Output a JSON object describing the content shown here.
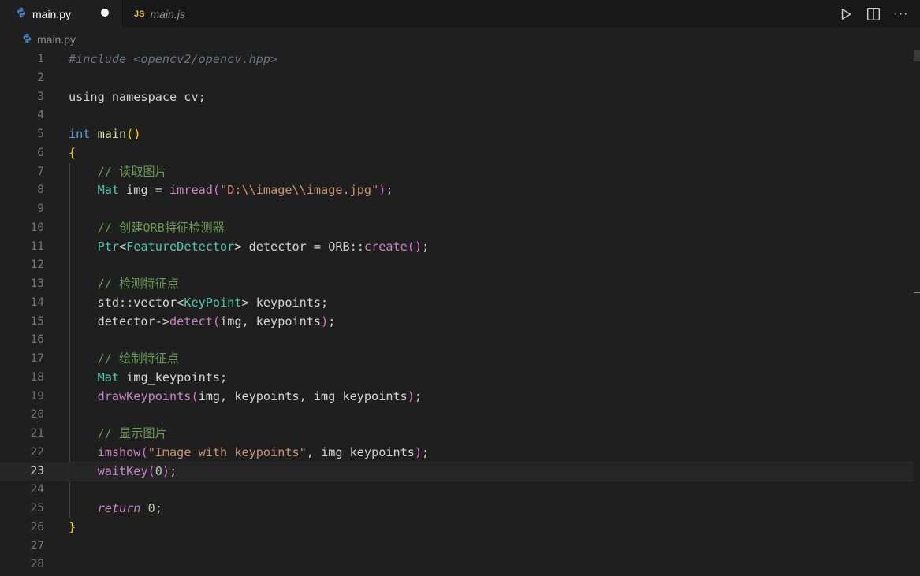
{
  "tabs": [
    {
      "label": "main.py",
      "icon": "python-icon",
      "active": true,
      "dirty": true
    },
    {
      "label": "main.js",
      "icon": "js-icon",
      "icon_text": "JS",
      "active": false
    }
  ],
  "actions": [
    {
      "name": "run-button",
      "icon": "play-icon"
    },
    {
      "name": "split-editor-button",
      "icon": "split-icon"
    },
    {
      "name": "more-actions-button",
      "icon": "ellipsis-icon",
      "glyph": "···"
    }
  ],
  "breadcrumb": {
    "file": "main.py",
    "icon": "python-icon"
  },
  "editor": {
    "current_line": 23,
    "lines": [
      {
        "n": "1",
        "tokens": [
          [
            "pp",
            "#include <opencv2/opencv.hpp>"
          ]
        ]
      },
      {
        "n": "2",
        "tokens": []
      },
      {
        "n": "3",
        "tokens": [
          [
            "pl",
            "using namespace cv;"
          ]
        ]
      },
      {
        "n": "4",
        "tokens": []
      },
      {
        "n": "5",
        "tokens": [
          [
            "kw",
            "int"
          ],
          [
            "pl",
            " "
          ],
          [
            "fn",
            "main"
          ],
          [
            "br",
            "()"
          ]
        ]
      },
      {
        "n": "6",
        "tokens": [
          [
            "br",
            "{"
          ]
        ]
      },
      {
        "n": "7",
        "tokens": [
          [
            "pl",
            "    "
          ],
          [
            "cm",
            "// 读取图片"
          ]
        ]
      },
      {
        "n": "8",
        "tokens": [
          [
            "pl",
            "    "
          ],
          [
            "ty",
            "Mat"
          ],
          [
            "pl",
            " img = "
          ],
          [
            "lfn",
            "imread"
          ],
          [
            "br2",
            "("
          ],
          [
            "str",
            "\"D:\\\\image\\\\image.jpg\""
          ],
          [
            "br2",
            ")"
          ],
          [
            "pl",
            ";"
          ]
        ]
      },
      {
        "n": "9",
        "tokens": []
      },
      {
        "n": "10",
        "tokens": [
          [
            "pl",
            "    "
          ],
          [
            "cm",
            "// 创建ORB特征检测器"
          ]
        ]
      },
      {
        "n": "11",
        "tokens": [
          [
            "pl",
            "    "
          ],
          [
            "ty",
            "Ptr"
          ],
          [
            "pl",
            "<"
          ],
          [
            "ty",
            "FeatureDetector"
          ],
          [
            "pl",
            "> detector = ORB::"
          ],
          [
            "lfn",
            "create"
          ],
          [
            "br2",
            "()"
          ],
          [
            "pl",
            ";"
          ]
        ]
      },
      {
        "n": "12",
        "tokens": []
      },
      {
        "n": "13",
        "tokens": [
          [
            "pl",
            "    "
          ],
          [
            "cm",
            "// 检测特征点"
          ]
        ]
      },
      {
        "n": "14",
        "tokens": [
          [
            "pl",
            "    std::vector<"
          ],
          [
            "ty",
            "KeyPoint"
          ],
          [
            "pl",
            "> keypoints;"
          ]
        ]
      },
      {
        "n": "15",
        "tokens": [
          [
            "pl",
            "    detector->"
          ],
          [
            "lfn",
            "detect"
          ],
          [
            "br2",
            "("
          ],
          [
            "pl",
            "img, keypoints"
          ],
          [
            "br2",
            ")"
          ],
          [
            "pl",
            ";"
          ]
        ]
      },
      {
        "n": "16",
        "tokens": []
      },
      {
        "n": "17",
        "tokens": [
          [
            "pl",
            "    "
          ],
          [
            "cm",
            "// 绘制特征点"
          ]
        ]
      },
      {
        "n": "18",
        "tokens": [
          [
            "pl",
            "    "
          ],
          [
            "ty",
            "Mat"
          ],
          [
            "pl",
            " img_keypoints;"
          ]
        ]
      },
      {
        "n": "19",
        "tokens": [
          [
            "pl",
            "    "
          ],
          [
            "lfn",
            "drawKeypoints"
          ],
          [
            "br2",
            "("
          ],
          [
            "pl",
            "img, keypoints, img_keypoints"
          ],
          [
            "br2",
            ")"
          ],
          [
            "pl",
            ";"
          ]
        ]
      },
      {
        "n": "20",
        "tokens": []
      },
      {
        "n": "21",
        "tokens": [
          [
            "pl",
            "    "
          ],
          [
            "cm",
            "// 显示图片"
          ]
        ]
      },
      {
        "n": "22",
        "tokens": [
          [
            "pl",
            "    "
          ],
          [
            "lfn",
            "imshow"
          ],
          [
            "br2",
            "("
          ],
          [
            "str",
            "\"Image with keypoints\""
          ],
          [
            "pl",
            ", img_keypoints"
          ],
          [
            "br2",
            ")"
          ],
          [
            "pl",
            ";"
          ]
        ]
      },
      {
        "n": "23",
        "tokens": [
          [
            "pl",
            "    "
          ],
          [
            "lfn",
            "waitKey"
          ],
          [
            "br2",
            "("
          ],
          [
            "num",
            "0"
          ],
          [
            "br2",
            ")"
          ],
          [
            "pl",
            ";"
          ]
        ]
      },
      {
        "n": "24",
        "tokens": []
      },
      {
        "n": "25",
        "tokens": [
          [
            "pl",
            "    "
          ],
          [
            "ret",
            "return"
          ],
          [
            "pl",
            " "
          ],
          [
            "num",
            "0"
          ],
          [
            "pl",
            ";"
          ]
        ]
      },
      {
        "n": "26",
        "tokens": [
          [
            "br",
            "}"
          ]
        ]
      },
      {
        "n": "27",
        "tokens": []
      },
      {
        "n": "28",
        "tokens": []
      }
    ]
  },
  "colors": {
    "editor_bg": "#1f1f1f",
    "tabbar_bg": "#181818",
    "comment": "#6a9955",
    "keyword": "#569cd6",
    "function": "#c586c0",
    "string": "#ce9178",
    "bracket": "#ffd700"
  }
}
